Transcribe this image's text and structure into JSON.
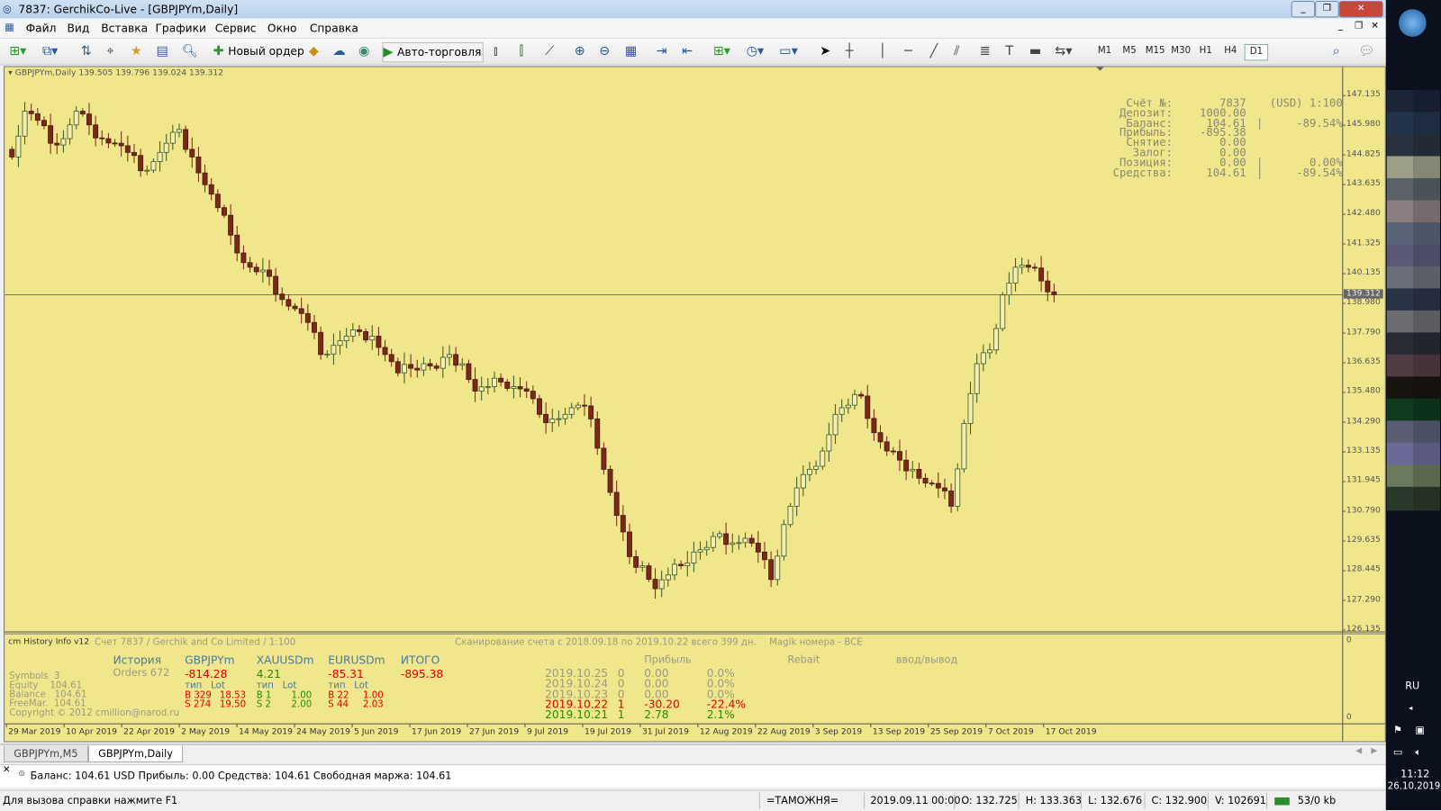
{
  "window": {
    "title": "7837: GerchikCo-Live - [GBPJPYm,Daily]"
  },
  "menu": [
    "Файл",
    "Вид",
    "Вставка",
    "Графики",
    "Сервис",
    "Окно",
    "Справка"
  ],
  "toolbar": {
    "new_order": "Новый ордер",
    "auto_trading": "Авто-торговля",
    "timeframes": [
      "M1",
      "M5",
      "M15",
      "M30",
      "H1",
      "H4",
      "D1"
    ],
    "active_timeframe": "D1"
  },
  "chart": {
    "header": "GBPJPYm,Daily  139.505 139.796 139.024 139.312",
    "current_price": "139.312",
    "price_min": 126.135,
    "price_max": 147.135,
    "price_labels": [
      "147.135",
      "145.980",
      "144.825",
      "143.635",
      "142.480",
      "141.325",
      "140.135",
      "138.980",
      "137.790",
      "136.635",
      "135.480",
      "134.290",
      "133.135",
      "131.945",
      "130.790",
      "129.635",
      "128.445",
      "127.290",
      "126.135"
    ],
    "time_labels": [
      "29 Mar 2019",
      "10 Apr 2019",
      "22 Apr 2019",
      "2 May 2019",
      "14 May 2019",
      "24 May 2019",
      "5 Jun 2019",
      "17 Jun 2019",
      "27 Jun 2019",
      "9 Jul 2019",
      "19 Jul 2019",
      "31 Jul 2019",
      "12 Aug 2019",
      "22 Aug 2019",
      "3 Sep 2019",
      "13 Sep 2019",
      "25 Sep 2019",
      "7 Oct 2019",
      "17 Oct 2019"
    ],
    "closes": [
      144.72,
      146.52,
      146.16,
      145.26,
      145.44,
      146.52,
      145.98,
      145.44,
      145.26,
      144.9,
      144.18,
      144.54,
      145.26,
      145.8,
      144.72,
      143.63,
      142.73,
      141.65,
      140.57,
      140.21,
      140.03,
      139.12,
      138.76,
      138.22,
      136.96,
      137.32,
      137.68,
      137.86,
      137.68,
      136.96,
      136.24,
      136.42,
      136.6,
      136.42,
      136.96,
      136.6,
      135.52,
      135.7,
      135.88,
      135.7,
      135.52,
      134.61,
      134.43,
      134.61,
      134.97,
      134.43,
      132.45,
      130.64,
      129.02,
      128.66,
      127.76,
      128.3,
      128.66,
      129.2,
      129.38,
      129.92,
      129.56,
      129.74,
      129.2,
      128.12,
      130.28,
      131.72,
      132.45,
      133.17,
      134.61,
      134.97,
      135.33,
      133.89,
      133.17,
      132.81,
      132.45,
      131.91,
      131.72,
      131.0,
      134.25,
      136.6,
      137.14,
      139.3,
      140.39,
      140.39,
      139.85,
      139.31
    ],
    "account_info": [
      {
        "label": "Счёт №:",
        "value": "7837",
        "extra": "(USD) 1:100"
      },
      {
        "label": "Депозит:",
        "value": "1000.00",
        "extra": ""
      },
      {
        "label": "Баланс:",
        "value": "104.61",
        "extra": "|     -89.54%"
      },
      {
        "label": "Прибыль:",
        "value": "-895.38",
        "extra": ""
      },
      {
        "label": "Снятие:",
        "value": "0.00",
        "extra": ""
      },
      {
        "label": "Залог:",
        "value": "0.00",
        "extra": ""
      },
      {
        "label": "Позиция:",
        "value": "0.00",
        "extra": "|       0.00%"
      },
      {
        "label": "Средства:",
        "value": "104.61",
        "extra": "|     -89.54%"
      }
    ]
  },
  "indicator": {
    "name": "cm History Info v12",
    "account": "Счет 7837 / Gerchik and Co Limited / 1:100",
    "scan": "Сканирование счета с 2018.09.18 по 2019.10.22 всего 399 дн.",
    "magic": "Magik номера - BCE",
    "stats": [
      "Symbols  3",
      "Equity    104.61",
      "Balance   104.61",
      "FreeMar.  104.61"
    ],
    "history": "История",
    "orders": "Orders 672",
    "symbols": [
      {
        "name": "GBPJPYm",
        "profit": "-814.28",
        "b": "B 329",
        "blot": "18.53",
        "s": "S 274",
        "slot": "19.50",
        "color": "red"
      },
      {
        "name": "XAUUSDm",
        "profit": "4.21",
        "b": "B 1",
        "blot": "1.00",
        "s": "S 2",
        "slot": "2.00",
        "color": "green"
      },
      {
        "name": "EURUSDm",
        "profit": "-85.31",
        "b": "B 22",
        "blot": "1.00",
        "s": "S 44",
        "slot": "2.03",
        "color": "red"
      }
    ],
    "type_lot": "тип   Lot",
    "total_label": "ИТОГО",
    "total": "-895.38",
    "col_profit": "Прибыль",
    "col_rebait": "Rebait",
    "col_io": "ввод/вывод",
    "days": [
      {
        "date": "2019.10.25",
        "n": "0",
        "p": "0.00",
        "pct": "0.0%",
        "color": "gray"
      },
      {
        "date": "2019.10.24",
        "n": "0",
        "p": "0.00",
        "pct": "0.0%",
        "color": "gray"
      },
      {
        "date": "2019.10.23",
        "n": "0",
        "p": "0.00",
        "pct": "0.0%",
        "color": "gray"
      },
      {
        "date": "2019.10.22",
        "n": "1",
        "p": "-30.20",
        "pct": "-22.4%",
        "color": "red"
      },
      {
        "date": "2019.10.21",
        "n": "1",
        "p": "2.78",
        "pct": "2.1%",
        "color": "green"
      }
    ],
    "copyright": "Copyright © 2012 cmillion@narod.ru",
    "axis_top": "0",
    "axis_bottom": "0"
  },
  "tabs": [
    "GBPJPYm,M5",
    "GBPJPYm,Daily"
  ],
  "terminal": {
    "line": "Баланс: 104.61 USD  Прибыль: 0.00  Средства: 104.61  Свободная маржа: 104.61"
  },
  "status": {
    "help": "Для вызова справки нажмите F1",
    "profile": "=ТАМОЖНЯ=",
    "time": "2019.09.11 00:00",
    "o": "O: 132.725",
    "h": "H: 133.363",
    "l": "L: 132.676",
    "c": "C: 132.900",
    "v": "V: 102691",
    "traffic": "53/0 kb"
  },
  "taskbar": {
    "lang": "RU",
    "clock": "11:12",
    "date": "26.10.2019"
  },
  "colors": {
    "chart_bg": "#f0e68c",
    "bull": "#3a5a2a",
    "bear": "#7a2818"
  }
}
